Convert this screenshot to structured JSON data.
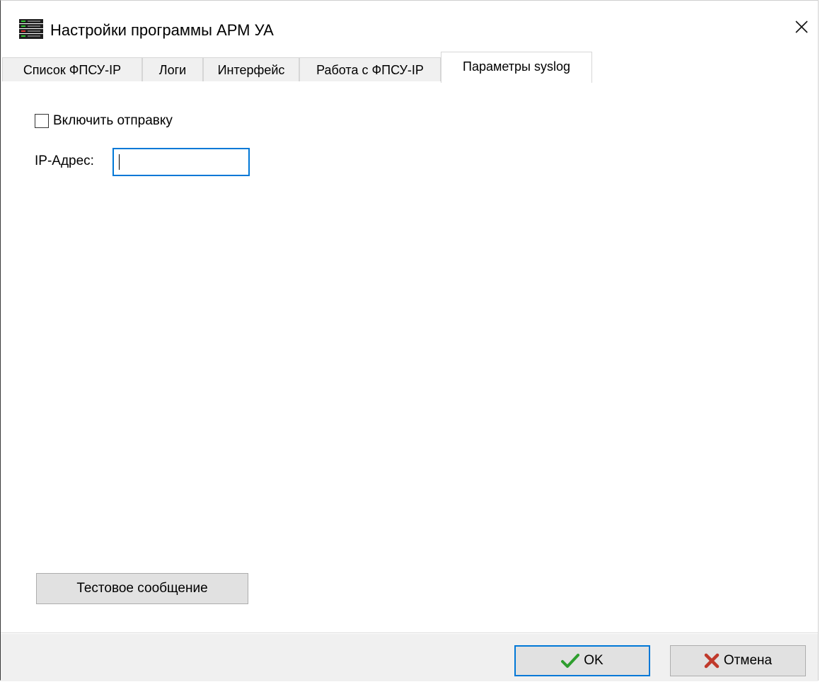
{
  "window": {
    "title": "Настройки программы АРМ УА",
    "icon": "server-rack-icon",
    "close_icon": "close-icon"
  },
  "tabs": [
    {
      "label": "Список ФПСУ-IP",
      "active": false
    },
    {
      "label": "Логи",
      "active": false
    },
    {
      "label": "Интерфейс",
      "active": false
    },
    {
      "label": "Работа с ФПСУ-IP",
      "active": false
    },
    {
      "label": "Параметры syslog",
      "active": true
    }
  ],
  "syslog": {
    "enable_label": "Включить отправку",
    "enable_checked": false,
    "ip_label": "IP-Адрес:",
    "ip_value": "",
    "test_button_label": "Тестовое сообщение"
  },
  "footer": {
    "ok_label": "OK",
    "ok_icon": "checkmark-icon",
    "cancel_label": "Отмена",
    "cancel_icon": "cross-icon"
  },
  "colors": {
    "accent": "#0078d7",
    "ok_check": "#2e9e2e",
    "cancel_cross": "#c0392b"
  }
}
